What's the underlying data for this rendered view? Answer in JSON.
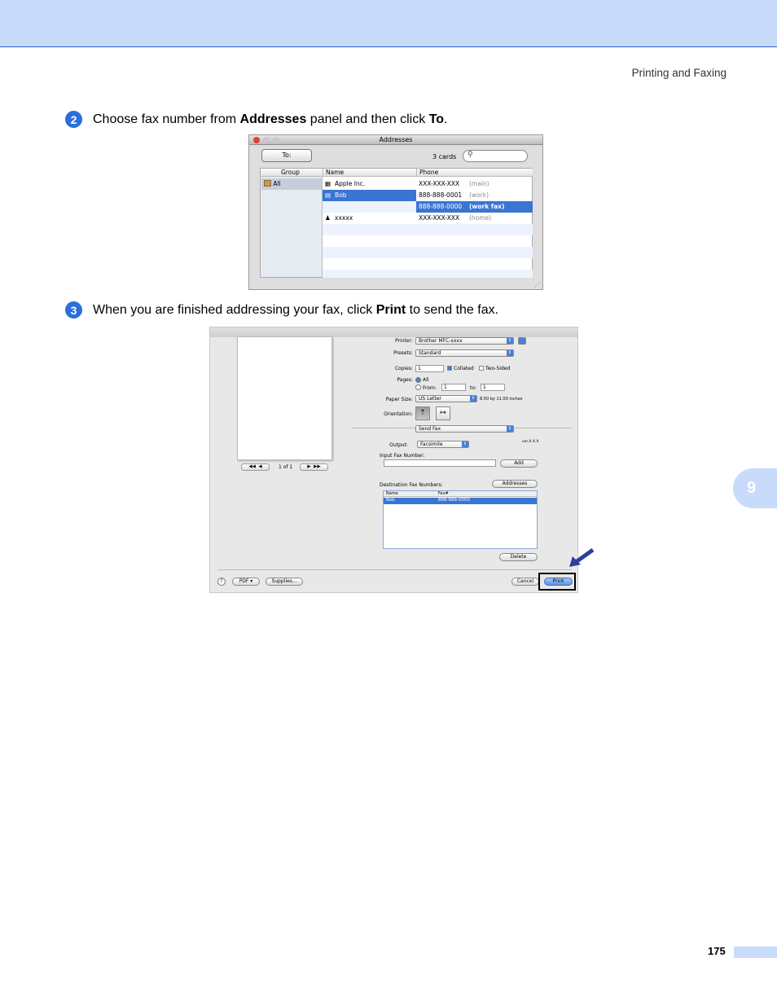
{
  "header": {
    "section_title": "Printing and Faxing"
  },
  "steps": [
    {
      "number": "2",
      "pre": "Choose fax number from ",
      "bold1": "Addresses",
      "mid": " panel and then click ",
      "bold2": "To",
      "post": "."
    },
    {
      "number": "3",
      "pre": "When you are finished addressing your fax, click ",
      "bold1": "Print",
      "post": " to send the fax."
    }
  ],
  "addresses_window": {
    "title": "Addresses",
    "to_button": "To:",
    "card_count": "3 cards",
    "columns": [
      "Group",
      "Name",
      "Phone"
    ],
    "group_all": "All",
    "rows": [
      {
        "name": "Apple Inc.",
        "phone": "XXX-XXX-XXX",
        "type": "(main)"
      },
      {
        "name": "Bob",
        "phone": "888-888-0001",
        "type": "(work)"
      },
      {
        "name": "",
        "phone": "888-888-0000",
        "type": "(work fax)"
      },
      {
        "name": "xxxxx",
        "phone": "XXX-XXX-XXX",
        "type": "(home)"
      }
    ]
  },
  "print_dialog": {
    "printer_label": "Printer:",
    "printer_value": "Brother MFC-xxxx",
    "presets_label": "Presets:",
    "presets_value": "Standard",
    "copies_label": "Copies:",
    "copies_value": "1",
    "collated": "Collated",
    "two_sided": "Two-Sided",
    "pages_label": "Pages:",
    "pages_all": "All",
    "pages_from": "From:",
    "from_value": "1",
    "to_label": "to:",
    "to_value": "1",
    "paper_size_label": "Paper Size:",
    "paper_size_value": "US Letter",
    "paper_dims": "8.50 by 11.00 inches",
    "orientation_label": "Orientation:",
    "section_value": "Send Fax",
    "output_label": "Output:",
    "output_value": "Facsimile",
    "version": "ver.X.X.X",
    "input_fax_label": "Input Fax Number:",
    "add_button": "Add",
    "dest_label": "Destination Fax Numbers:",
    "addresses_button": "Addresses",
    "list_headers": [
      "Name",
      "Fax#"
    ],
    "list_rows": [
      {
        "name": "Bob",
        "fax": "888-888-0000"
      }
    ],
    "delete_button": "Delete",
    "page_indicator": "1 of 1",
    "pdf_button": "PDF ▾",
    "supplies_button": "Supplies...",
    "cancel_button": "Cancel",
    "print_button": "Print",
    "help": "?"
  },
  "chapter": "9",
  "page_number": "175"
}
